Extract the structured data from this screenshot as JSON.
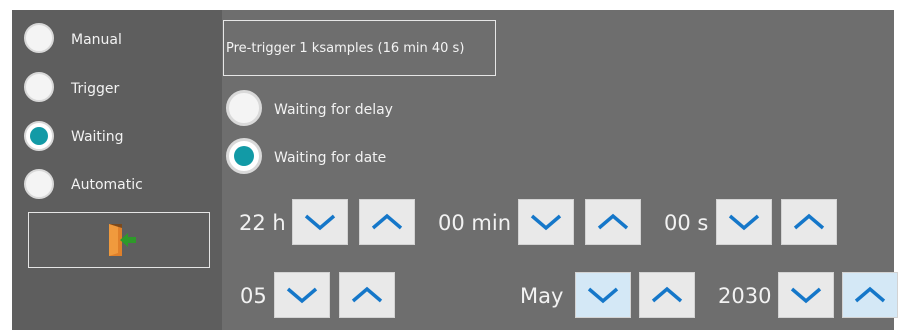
{
  "modes": [
    {
      "label": "Manual",
      "selected": false
    },
    {
      "label": "Trigger",
      "selected": false
    },
    {
      "label": "Waiting",
      "selected": true
    },
    {
      "label": "Automatic",
      "selected": false
    }
  ],
  "pretrigger_text": "Pre-trigger 1 ksamples (16 min 40 s)",
  "waiting_options": [
    {
      "label": "Waiting for delay",
      "selected": false
    },
    {
      "label": "Waiting for date",
      "selected": true
    }
  ],
  "time": {
    "hour": "22 h",
    "minute": "00 min",
    "second": "00 s"
  },
  "date": {
    "day": "05",
    "month": "May",
    "year": "2030"
  },
  "icons": {
    "down": "chevron-down-icon",
    "up": "chevron-up-icon",
    "exit": "exit-door-icon"
  },
  "colors": {
    "panel": "#6e6e6e",
    "sidebar": "#5e5e5e",
    "accent": "#129aa6",
    "chevron": "#1577c9",
    "button": "#e9e9e9"
  }
}
